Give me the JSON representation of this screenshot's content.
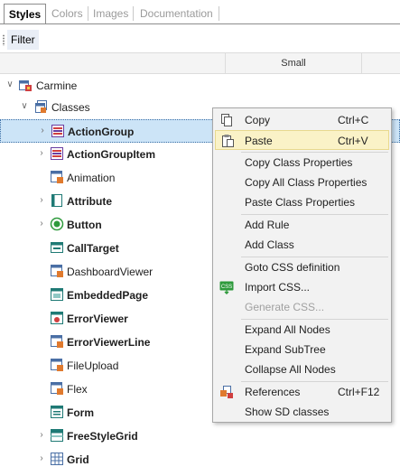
{
  "tabs": [
    {
      "label": "Styles",
      "active": true
    },
    {
      "label": "Colors",
      "active": false
    },
    {
      "label": "Images",
      "active": false
    },
    {
      "label": "Documentation",
      "active": false
    }
  ],
  "toolbar": {
    "filter_label": "Filter"
  },
  "header": {
    "column_small": "Small"
  },
  "tree": {
    "root": {
      "label": "Carmine",
      "icon": "style-object-icon",
      "expanded": true
    },
    "classes": {
      "label": "Classes",
      "icon": "classes-folder-icon",
      "expanded": true
    },
    "items": [
      {
        "label": "ActionGroup",
        "icon": "action-group-icon",
        "bold": true,
        "expandable": true,
        "selected": true
      },
      {
        "label": "ActionGroupItem",
        "icon": "action-group-item-icon",
        "bold": true,
        "expandable": true,
        "selected": false
      },
      {
        "label": "Animation",
        "icon": "class-icon",
        "bold": false,
        "expandable": false,
        "selected": false
      },
      {
        "label": "Attribute",
        "icon": "attribute-icon",
        "bold": true,
        "expandable": true,
        "selected": false
      },
      {
        "label": "Button",
        "icon": "button-icon",
        "bold": true,
        "expandable": true,
        "selected": false
      },
      {
        "label": "CallTarget",
        "icon": "call-target-icon",
        "bold": true,
        "expandable": false,
        "selected": false
      },
      {
        "label": "DashboardViewer",
        "icon": "class-icon",
        "bold": false,
        "expandable": false,
        "selected": false
      },
      {
        "label": "EmbeddedPage",
        "icon": "embedded-page-icon",
        "bold": true,
        "expandable": false,
        "selected": false
      },
      {
        "label": "ErrorViewer",
        "icon": "error-viewer-icon",
        "bold": true,
        "expandable": false,
        "selected": false
      },
      {
        "label": "ErrorViewerLine",
        "icon": "class-icon",
        "bold": true,
        "expandable": false,
        "selected": false
      },
      {
        "label": "FileUpload",
        "icon": "class-icon",
        "bold": false,
        "expandable": false,
        "selected": false
      },
      {
        "label": "Flex",
        "icon": "class-icon",
        "bold": false,
        "expandable": false,
        "selected": false
      },
      {
        "label": "Form",
        "icon": "form-icon",
        "bold": true,
        "expandable": false,
        "selected": false
      },
      {
        "label": "FreeStyleGrid",
        "icon": "freestyle-grid-icon",
        "bold": true,
        "expandable": true,
        "selected": false
      },
      {
        "label": "Grid",
        "icon": "grid-icon",
        "bold": true,
        "expandable": true,
        "selected": false
      }
    ]
  },
  "context_menu": {
    "items": [
      {
        "label": "Copy",
        "shortcut": "Ctrl+C",
        "icon": "copy-icon",
        "highlighted": false,
        "disabled": false
      },
      {
        "label": "Paste",
        "shortcut": "Ctrl+V",
        "icon": "paste-icon",
        "highlighted": true,
        "disabled": false
      },
      {
        "label": "Copy Class Properties",
        "shortcut": "",
        "icon": "",
        "highlighted": false,
        "disabled": false
      },
      {
        "label": "Copy All Class Properties",
        "shortcut": "",
        "icon": "",
        "highlighted": false,
        "disabled": false
      },
      {
        "label": "Paste Class Properties",
        "shortcut": "",
        "icon": "",
        "highlighted": false,
        "disabled": false
      },
      {
        "label": "Add Rule",
        "shortcut": "",
        "icon": "",
        "highlighted": false,
        "disabled": false
      },
      {
        "label": "Add Class",
        "shortcut": "",
        "icon": "",
        "highlighted": false,
        "disabled": false
      },
      {
        "label": "Goto CSS definition",
        "shortcut": "",
        "icon": "",
        "highlighted": false,
        "disabled": false
      },
      {
        "label": "Import CSS...",
        "shortcut": "",
        "icon": "import-css-icon",
        "icon_text": "CSS",
        "highlighted": false,
        "disabled": false
      },
      {
        "label": "Generate CSS...",
        "shortcut": "",
        "icon": "",
        "highlighted": false,
        "disabled": true
      },
      {
        "label": "Expand All Nodes",
        "shortcut": "",
        "icon": "",
        "highlighted": false,
        "disabled": false
      },
      {
        "label": "Expand SubTree",
        "shortcut": "",
        "icon": "",
        "highlighted": false,
        "disabled": false
      },
      {
        "label": "Collapse All Nodes",
        "shortcut": "",
        "icon": "",
        "highlighted": false,
        "disabled": false
      },
      {
        "label": "References",
        "shortcut": "Ctrl+F12",
        "icon": "references-icon",
        "highlighted": false,
        "disabled": false
      },
      {
        "label": "Show SD classes",
        "shortcut": "",
        "icon": "",
        "highlighted": false,
        "disabled": false
      }
    ]
  },
  "colors": {
    "selection": "#cce4f7",
    "menu_highlight": "#faf2c7",
    "menu_bg": "#f2f2f2",
    "css_icon_green": "#2e9a3c"
  }
}
